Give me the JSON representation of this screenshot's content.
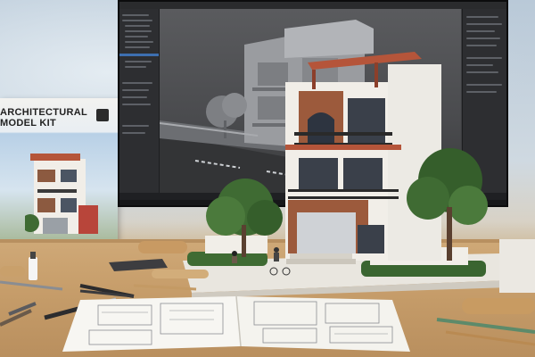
{
  "box": {
    "title_line1": "ARCHITECTURAL",
    "title_line2": "MODEL KIT",
    "logo_icon": "building-logo-icon"
  },
  "monitor": {
    "software": "3d-modeling-software-icon",
    "panels": [
      "left-outliner-panel",
      "right-properties-panel"
    ]
  },
  "scene": {
    "model": "townhouse-architectural-model",
    "items": [
      "blueprint-booklet",
      "pencils",
      "ruler",
      "paper-roll",
      "craft-knife",
      "pliers",
      "glue-bottle"
    ]
  },
  "colors": {
    "sky": "#b9c9d8",
    "desk": "#c79e6b",
    "brick": "#9c5a3c",
    "roof": "#b5553a",
    "wall": "#f1eee8",
    "foliage": "#3f6b33",
    "screen_bg": "#3c3d40"
  }
}
